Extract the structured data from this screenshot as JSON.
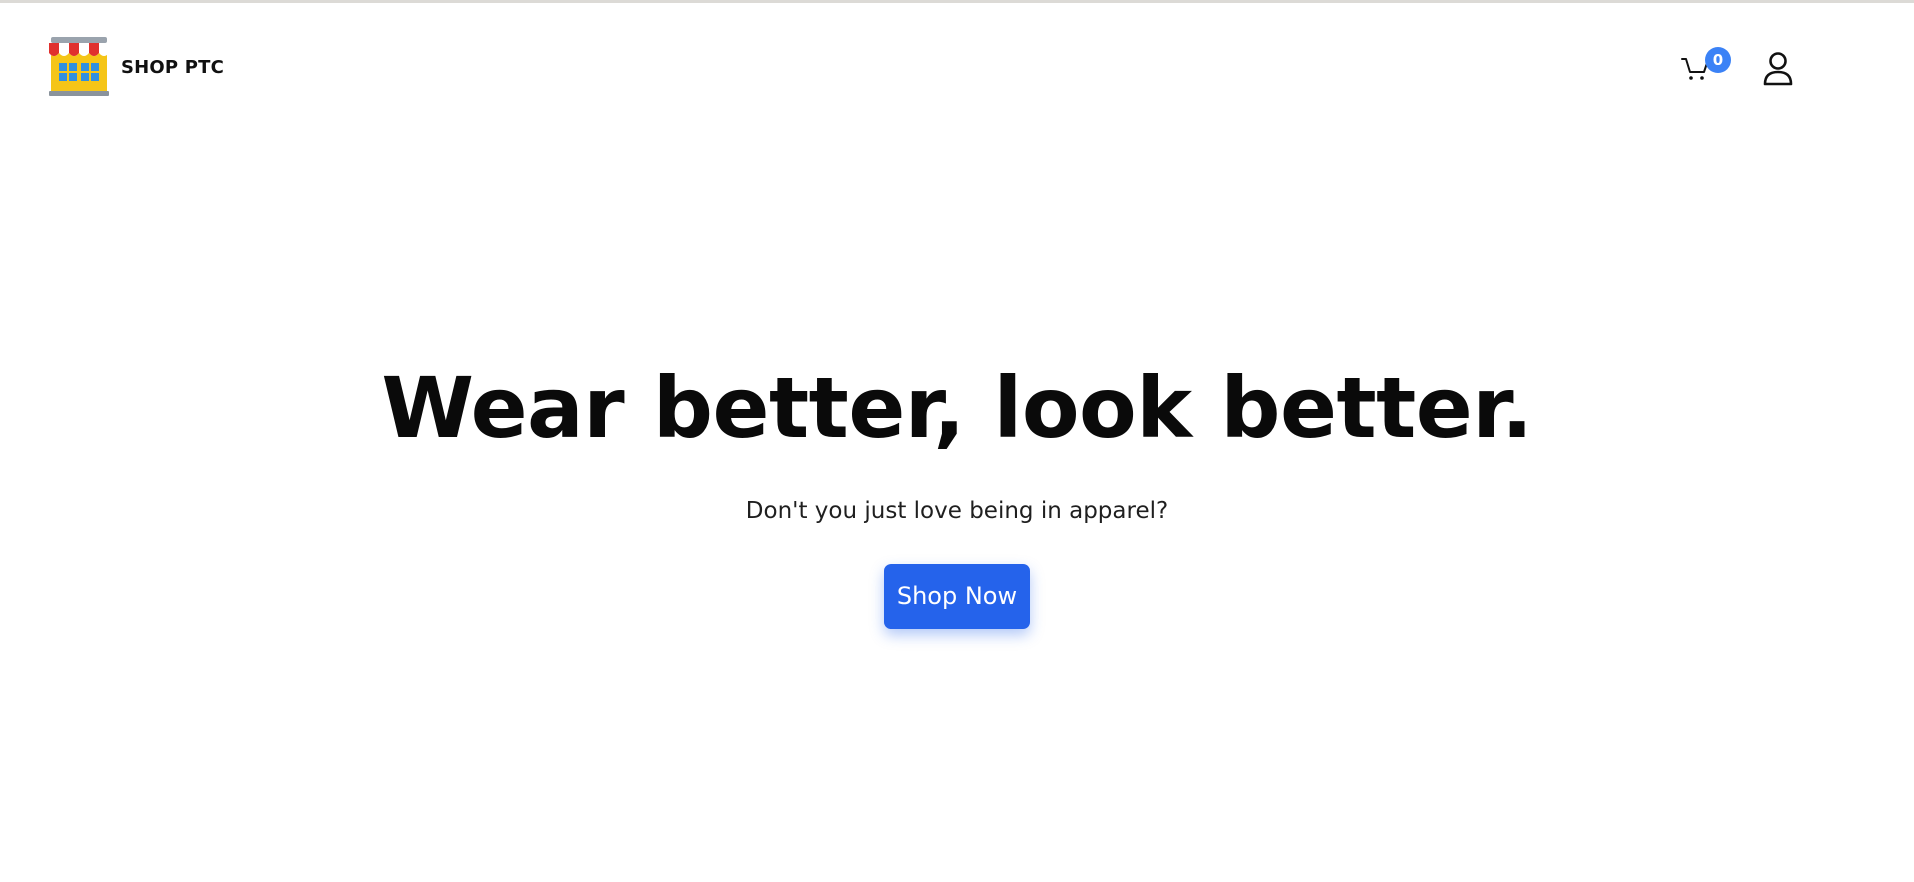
{
  "header": {
    "brand_name": "SHOP PTC",
    "logo_icon": "store-icon",
    "cart_icon": "cart-icon",
    "cart_count": "0",
    "account_icon": "user-icon"
  },
  "hero": {
    "title": "Wear better, look better.",
    "subtitle": "Don't you just love being in apparel?",
    "cta_label": "Shop Now"
  },
  "colors": {
    "accent": "#2563eb",
    "badge": "#3b82f6",
    "text": "#0a0a0a",
    "background": "#ffffff"
  }
}
